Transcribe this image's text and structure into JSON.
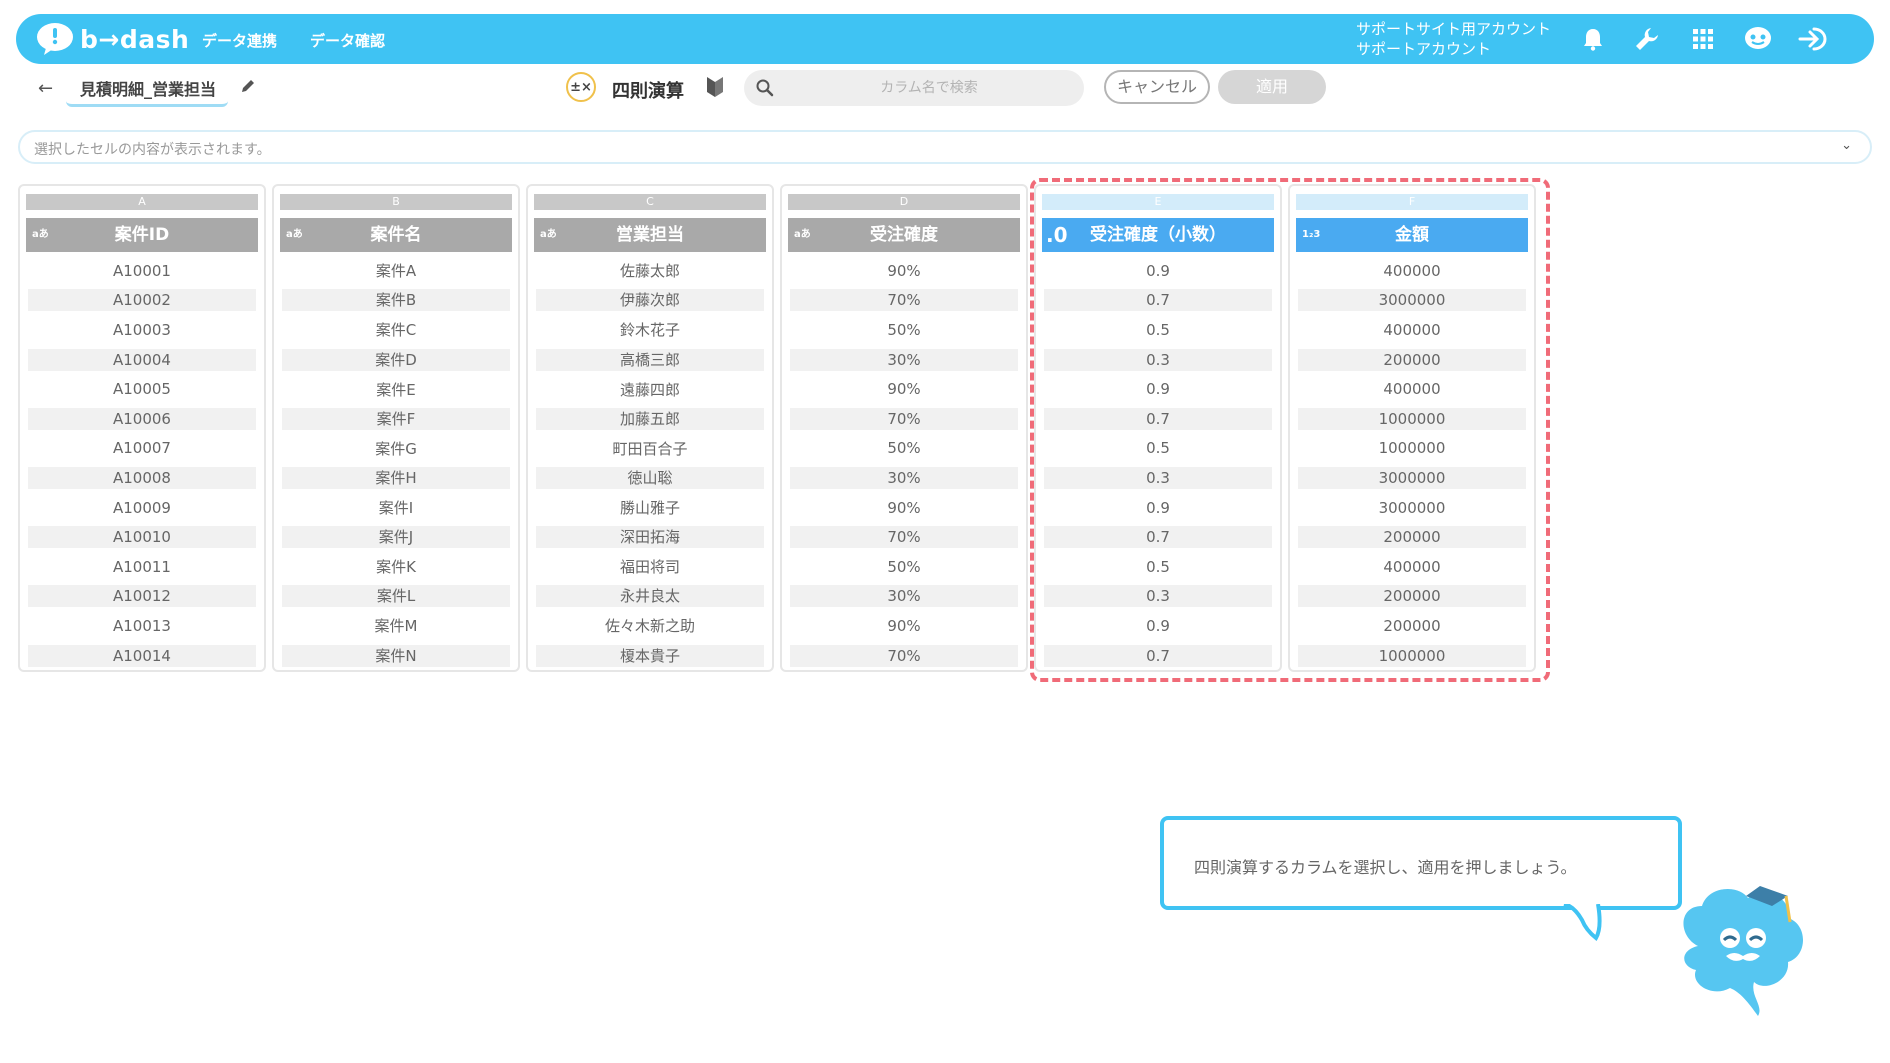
{
  "header": {
    "logo_text": "b→dash",
    "nav": [
      "データ連携",
      "データ確認"
    ],
    "account_line1": "サポートサイト用アカウント",
    "account_line2": "サポートアカウント",
    "icons": [
      "bell-icon",
      "wrench-icon",
      "grid-icon",
      "chat-icon",
      "logout-icon"
    ]
  },
  "toolbar": {
    "back_icon": "arrow-left-icon",
    "doc_title": "見積明細_営業担当",
    "operation_title": "四則演算",
    "search_placeholder": "カラム名で検索",
    "cancel_label": "キャンセル",
    "apply_label": "適用"
  },
  "cell_bar": {
    "placeholder": "選択したセルの内容が表示されます。"
  },
  "columns": [
    {
      "letter": "A",
      "type": "aあ",
      "name": "案件ID",
      "selected": false,
      "values": [
        "A10001",
        "A10002",
        "A10003",
        "A10004",
        "A10005",
        "A10006",
        "A10007",
        "A10008",
        "A10009",
        "A10010",
        "A10011",
        "A10012",
        "A10013",
        "A10014"
      ]
    },
    {
      "letter": "B",
      "type": "aあ",
      "name": "案件名",
      "selected": false,
      "values": [
        "案件A",
        "案件B",
        "案件C",
        "案件D",
        "案件E",
        "案件F",
        "案件G",
        "案件H",
        "案件I",
        "案件J",
        "案件K",
        "案件L",
        "案件M",
        "案件N"
      ]
    },
    {
      "letter": "C",
      "type": "aあ",
      "name": "営業担当",
      "selected": false,
      "values": [
        "佐藤太郎",
        "伊藤次郎",
        "鈴木花子",
        "高橋三郎",
        "遠藤四郎",
        "加藤五郎",
        "町田百合子",
        "徳山聡",
        "勝山雅子",
        "深田拓海",
        "福田将司",
        "永井良太",
        "佐々木新之助",
        "榎本貴子"
      ]
    },
    {
      "letter": "D",
      "type": "aあ",
      "name": "受注確度",
      "selected": false,
      "values": [
        "90%",
        "70%",
        "50%",
        "30%",
        "90%",
        "70%",
        "50%",
        "30%",
        "90%",
        "70%",
        "50%",
        "30%",
        "90%",
        "70%"
      ]
    },
    {
      "letter": "E",
      "type": ".0",
      "name": "受注確度（小数）",
      "selected": true,
      "values": [
        "0.9",
        "0.7",
        "0.5",
        "0.3",
        "0.9",
        "0.7",
        "0.5",
        "0.3",
        "0.9",
        "0.7",
        "0.5",
        "0.3",
        "0.9",
        "0.7"
      ]
    },
    {
      "letter": "F",
      "type": "1₂3",
      "name": "金額",
      "selected": true,
      "values": [
        "400000",
        "3000000",
        "400000",
        "200000",
        "400000",
        "1000000",
        "1000000",
        "3000000",
        "3000000",
        "200000",
        "400000",
        "200000",
        "200000",
        "1000000"
      ]
    }
  ],
  "tooltip": {
    "text": "四則演算するカラムを選択し、適用を押しましょう。"
  },
  "colors": {
    "accent": "#3fc3f3",
    "selected_header": "#4aaaf1",
    "highlight_dash": "#f06b78",
    "header_gray": "#a9a9a9"
  }
}
